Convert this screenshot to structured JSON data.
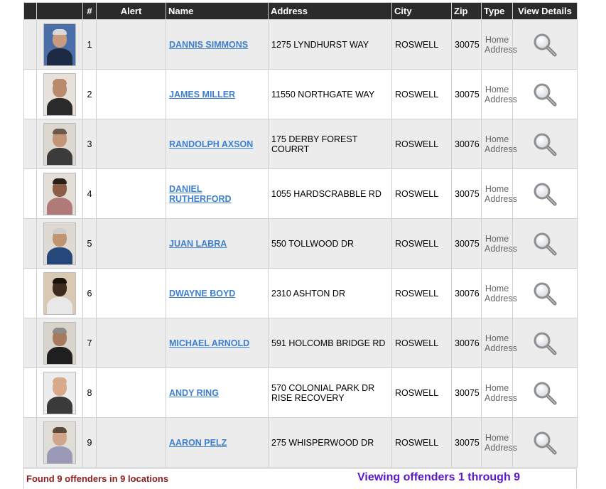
{
  "headers": {
    "photo": "",
    "num": "#",
    "alert": "Alert",
    "name": "Name",
    "address": "Address",
    "city": "City",
    "zip": "Zip",
    "type": "Type",
    "view": "View Details"
  },
  "rows": [
    {
      "num": "1",
      "name": "DANNIS SIMMONS",
      "address": "1275 LYNDHURST WAY",
      "city": "ROSWELL",
      "zip": "30075",
      "type_line1": "Home",
      "type_line2": "Address",
      "photo": {
        "wall": "#4a6fa8",
        "skin": "#c99a7e",
        "shirt": "#1c2a44",
        "hair": "#d9d9d9"
      }
    },
    {
      "num": "2",
      "name": "JAMES MILLER",
      "address": "11550 NORTHGATE WAY",
      "city": "ROSWELL",
      "zip": "30075",
      "type_line1": "Home",
      "type_line2": "Address",
      "photo": {
        "wall": "#e6e2db",
        "skin": "#b98a6e",
        "shirt": "#2a2a2a",
        "hair": "#b98a6e"
      }
    },
    {
      "num": "3",
      "name": "RANDOLPH AXSON",
      "address": "175 DERBY FOREST COURRT",
      "city": "ROSWELL",
      "zip": "30076",
      "type_line1": "Home",
      "type_line2": "Address",
      "photo": {
        "wall": "#dcd8d0",
        "skin": "#c29478",
        "shirt": "#3b3b3b",
        "hair": "#6b5a4b"
      }
    },
    {
      "num": "4",
      "name": "DANIEL RUTHERFORD",
      "address": "1055 HARDSCRABBLE RD",
      "city": "ROSWELL",
      "zip": "30075",
      "type_line1": "Home",
      "type_line2": "Address",
      "photo": {
        "wall": "#e3dfd8",
        "skin": "#8b5e45",
        "shirt": "#b07a78",
        "hair": "#2a1f18"
      }
    },
    {
      "num": "5",
      "name": "JUAN LABRA",
      "address": "550 TOLLWOOD DR",
      "city": "ROSWELL",
      "zip": "30075",
      "type_line1": "Home",
      "type_line2": "Address",
      "photo": {
        "wall": "#dedad3",
        "skin": "#c0946f",
        "shirt": "#25477a",
        "hair": "#cfcfcf"
      }
    },
    {
      "num": "6",
      "name": "DWAYNE BOYD",
      "address": "2310 ASHTON DR",
      "city": "ROSWELL",
      "zip": "30076",
      "type_line1": "Home",
      "type_line2": "Address",
      "photo": {
        "wall": "#d9c9b2",
        "skin": "#3f2a1f",
        "shirt": "#e8e8e8",
        "hair": "#1a120d"
      }
    },
    {
      "num": "7",
      "name": "MICHAEL ARNOLD",
      "address": "591 HOLCOMB BRIDGE RD",
      "city": "ROSWELL",
      "zip": "30076",
      "type_line1": "Home",
      "type_line2": "Address",
      "photo": {
        "wall": "#d8d4cc",
        "skin": "#a77a5f",
        "shirt": "#1f1f1f",
        "hair": "#8a8a8a"
      }
    },
    {
      "num": "8",
      "name": "ANDY RING",
      "address": "570 COLONIAL PARK DR RISE RECOVERY",
      "city": "ROSWELL",
      "zip": "30075",
      "type_line1": "Home",
      "type_line2": "Address",
      "photo": {
        "wall": "#ececec",
        "skin": "#d9a98b",
        "shirt": "#3a3a3a",
        "hair": "#d9a98b"
      }
    },
    {
      "num": "9",
      "name": "AARON PELZ",
      "address": "275 WHISPERWOOD DR",
      "city": "ROSWELL",
      "zip": "30075",
      "type_line1": "Home",
      "type_line2": "Address",
      "photo": {
        "wall": "#e0ddd6",
        "skin": "#d1a58a",
        "shirt": "#9a9ab6",
        "hair": "#5b4a3c"
      }
    }
  ],
  "footer": {
    "found": "Found 9 offenders in 9 locations",
    "viewing": "Viewing offenders 1 through 9"
  },
  "colors": {
    "header_bg": "#2b2b2b",
    "name_link": "#3d7fd1",
    "found_text": "#8b1f1f",
    "viewing_text": "#5a18c9",
    "row_alt": "#ececec"
  },
  "icons": {
    "view": "magnifier-icon"
  }
}
